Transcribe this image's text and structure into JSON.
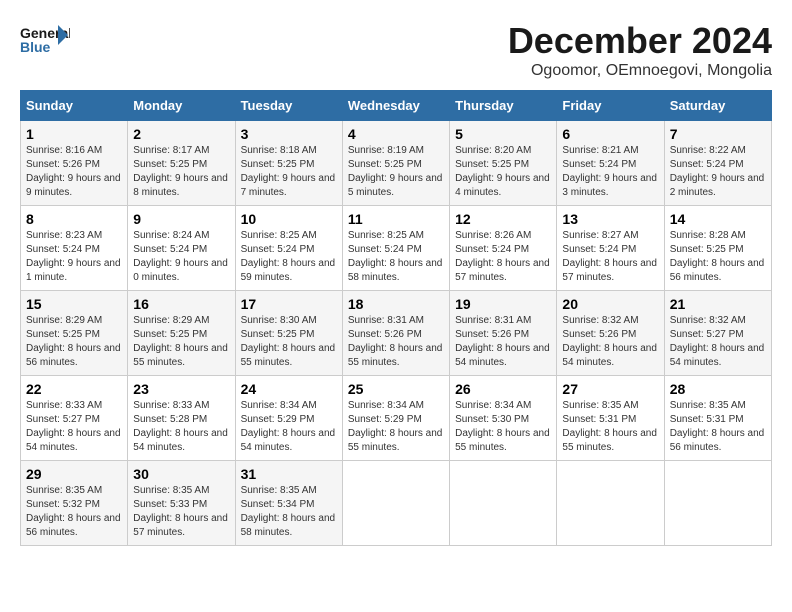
{
  "header": {
    "logo_text_general": "General",
    "logo_text_blue": "Blue",
    "month": "December 2024",
    "location": "Ogoomor, OEmnoegovi, Mongolia"
  },
  "days_of_week": [
    "Sunday",
    "Monday",
    "Tuesday",
    "Wednesday",
    "Thursday",
    "Friday",
    "Saturday"
  ],
  "weeks": [
    [
      {
        "day": "1",
        "sunrise": "8:16 AM",
        "sunset": "5:26 PM",
        "daylight": "9 hours and 9 minutes."
      },
      {
        "day": "2",
        "sunrise": "8:17 AM",
        "sunset": "5:25 PM",
        "daylight": "9 hours and 8 minutes."
      },
      {
        "day": "3",
        "sunrise": "8:18 AM",
        "sunset": "5:25 PM",
        "daylight": "9 hours and 7 minutes."
      },
      {
        "day": "4",
        "sunrise": "8:19 AM",
        "sunset": "5:25 PM",
        "daylight": "9 hours and 5 minutes."
      },
      {
        "day": "5",
        "sunrise": "8:20 AM",
        "sunset": "5:25 PM",
        "daylight": "9 hours and 4 minutes."
      },
      {
        "day": "6",
        "sunrise": "8:21 AM",
        "sunset": "5:24 PM",
        "daylight": "9 hours and 3 minutes."
      },
      {
        "day": "7",
        "sunrise": "8:22 AM",
        "sunset": "5:24 PM",
        "daylight": "9 hours and 2 minutes."
      }
    ],
    [
      {
        "day": "8",
        "sunrise": "8:23 AM",
        "sunset": "5:24 PM",
        "daylight": "9 hours and 1 minute."
      },
      {
        "day": "9",
        "sunrise": "8:24 AM",
        "sunset": "5:24 PM",
        "daylight": "9 hours and 0 minutes."
      },
      {
        "day": "10",
        "sunrise": "8:25 AM",
        "sunset": "5:24 PM",
        "daylight": "8 hours and 59 minutes."
      },
      {
        "day": "11",
        "sunrise": "8:25 AM",
        "sunset": "5:24 PM",
        "daylight": "8 hours and 58 minutes."
      },
      {
        "day": "12",
        "sunrise": "8:26 AM",
        "sunset": "5:24 PM",
        "daylight": "8 hours and 57 minutes."
      },
      {
        "day": "13",
        "sunrise": "8:27 AM",
        "sunset": "5:24 PM",
        "daylight": "8 hours and 57 minutes."
      },
      {
        "day": "14",
        "sunrise": "8:28 AM",
        "sunset": "5:25 PM",
        "daylight": "8 hours and 56 minutes."
      }
    ],
    [
      {
        "day": "15",
        "sunrise": "8:29 AM",
        "sunset": "5:25 PM",
        "daylight": "8 hours and 56 minutes."
      },
      {
        "day": "16",
        "sunrise": "8:29 AM",
        "sunset": "5:25 PM",
        "daylight": "8 hours and 55 minutes."
      },
      {
        "day": "17",
        "sunrise": "8:30 AM",
        "sunset": "5:25 PM",
        "daylight": "8 hours and 55 minutes."
      },
      {
        "day": "18",
        "sunrise": "8:31 AM",
        "sunset": "5:26 PM",
        "daylight": "8 hours and 55 minutes."
      },
      {
        "day": "19",
        "sunrise": "8:31 AM",
        "sunset": "5:26 PM",
        "daylight": "8 hours and 54 minutes."
      },
      {
        "day": "20",
        "sunrise": "8:32 AM",
        "sunset": "5:26 PM",
        "daylight": "8 hours and 54 minutes."
      },
      {
        "day": "21",
        "sunrise": "8:32 AM",
        "sunset": "5:27 PM",
        "daylight": "8 hours and 54 minutes."
      }
    ],
    [
      {
        "day": "22",
        "sunrise": "8:33 AM",
        "sunset": "5:27 PM",
        "daylight": "8 hours and 54 minutes."
      },
      {
        "day": "23",
        "sunrise": "8:33 AM",
        "sunset": "5:28 PM",
        "daylight": "8 hours and 54 minutes."
      },
      {
        "day": "24",
        "sunrise": "8:34 AM",
        "sunset": "5:29 PM",
        "daylight": "8 hours and 54 minutes."
      },
      {
        "day": "25",
        "sunrise": "8:34 AM",
        "sunset": "5:29 PM",
        "daylight": "8 hours and 55 minutes."
      },
      {
        "day": "26",
        "sunrise": "8:34 AM",
        "sunset": "5:30 PM",
        "daylight": "8 hours and 55 minutes."
      },
      {
        "day": "27",
        "sunrise": "8:35 AM",
        "sunset": "5:31 PM",
        "daylight": "8 hours and 55 minutes."
      },
      {
        "day": "28",
        "sunrise": "8:35 AM",
        "sunset": "5:31 PM",
        "daylight": "8 hours and 56 minutes."
      }
    ],
    [
      {
        "day": "29",
        "sunrise": "8:35 AM",
        "sunset": "5:32 PM",
        "daylight": "8 hours and 56 minutes."
      },
      {
        "day": "30",
        "sunrise": "8:35 AM",
        "sunset": "5:33 PM",
        "daylight": "8 hours and 57 minutes."
      },
      {
        "day": "31",
        "sunrise": "8:35 AM",
        "sunset": "5:34 PM",
        "daylight": "8 hours and 58 minutes."
      },
      null,
      null,
      null,
      null
    ]
  ],
  "labels": {
    "sunrise": "Sunrise:",
    "sunset": "Sunset:",
    "daylight": "Daylight:"
  }
}
